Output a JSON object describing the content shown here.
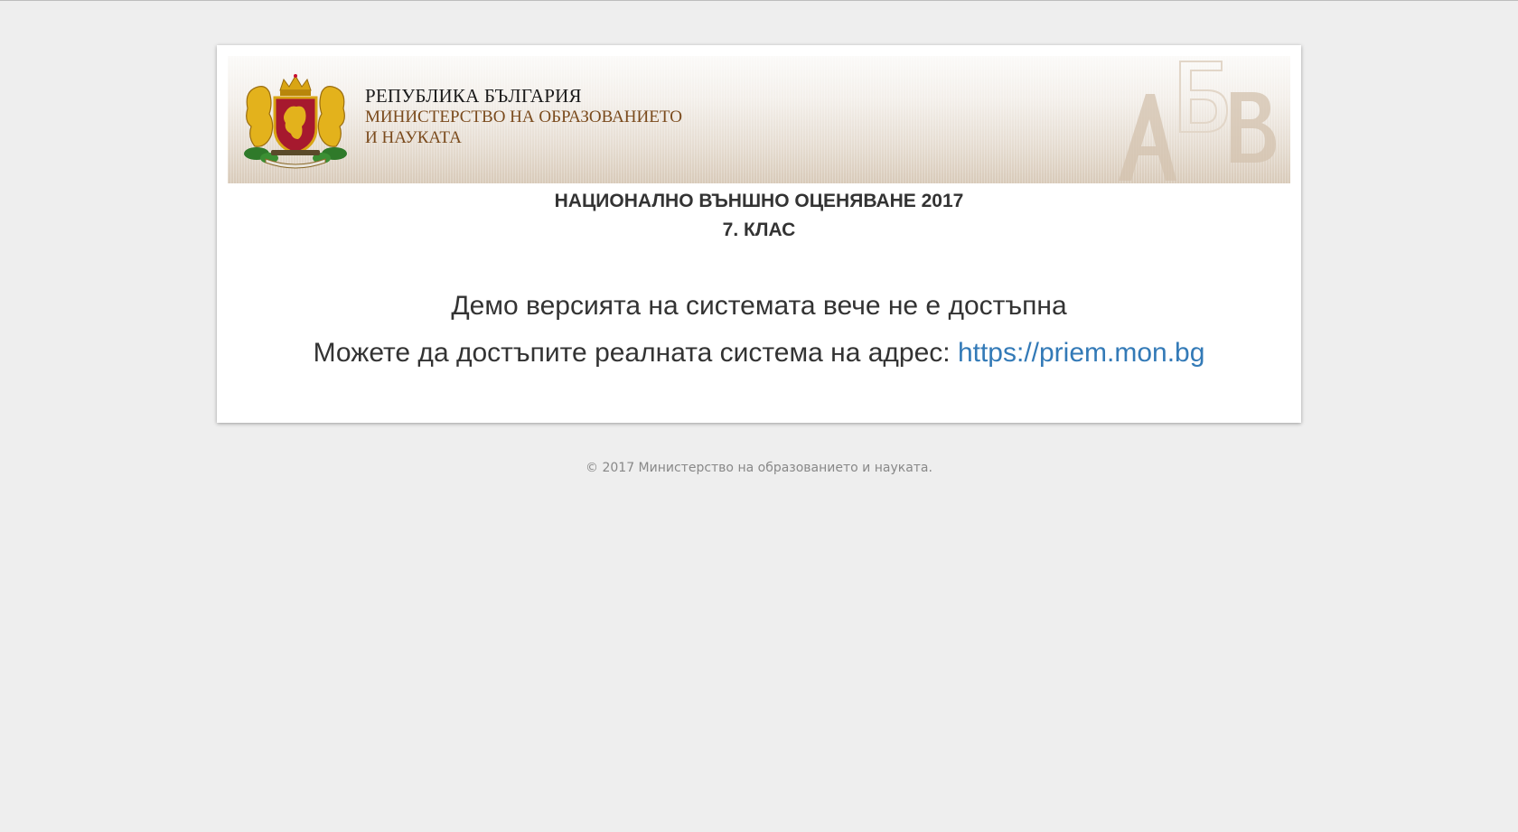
{
  "header": {
    "country": "РЕПУБЛИКА БЪЛГАРИЯ",
    "ministry_line1": "МИНИСТЕРСТВО НА ОБРАЗОВАНИЕТО",
    "ministry_line2": "И НАУКАТА",
    "crest_icon": "bulgarian-coat-of-arms",
    "decor_letters": "АБВ"
  },
  "main": {
    "title": "НАЦИОНАЛНО ВЪНШНО ОЦЕНЯВАНЕ 2017",
    "subtitle": "7. КЛАС",
    "message": "Демо версията на системата вече не е достъпна",
    "redirect_prefix": "Можете да достъпите реалната система на адрес:",
    "redirect_link": "https://priem.mon.bg"
  },
  "footer": {
    "copyright": "© 2017 Министерство на образованието и науката."
  },
  "colors": {
    "background": "#eeeeee",
    "card": "#ffffff",
    "text": "#333333",
    "link": "#337ab7",
    "ministry_text": "#7a4a1c",
    "footer_text": "#888888"
  }
}
